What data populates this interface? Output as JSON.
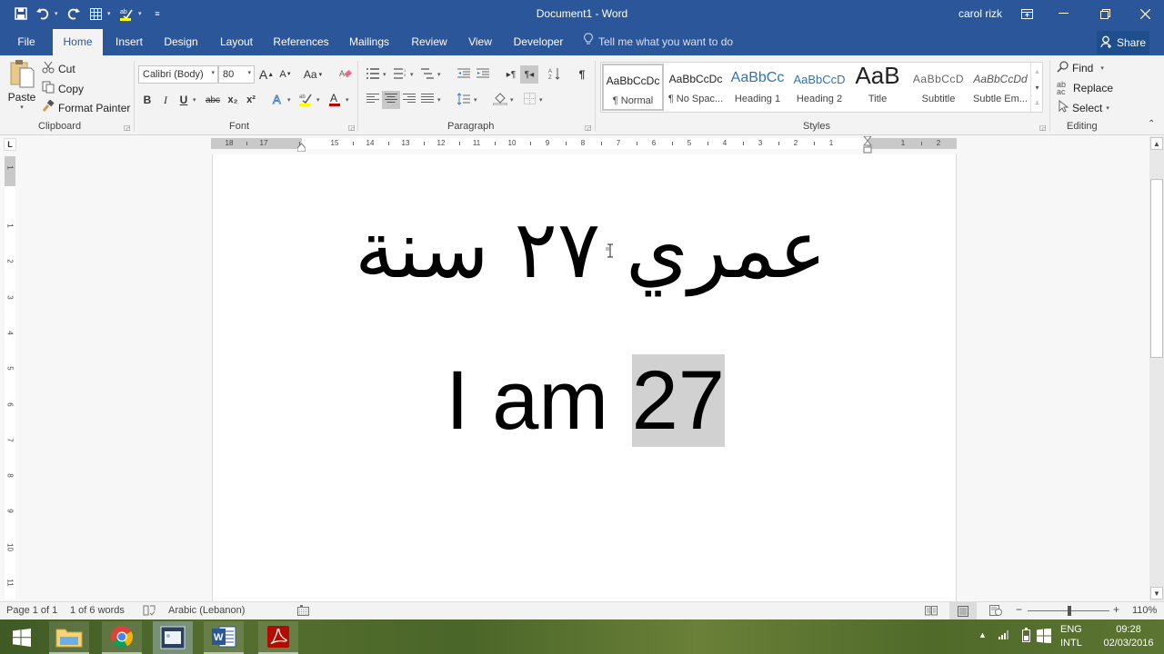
{
  "window": {
    "title": "Document1 - Word",
    "user": "carol rizk"
  },
  "quick_access": {
    "items": [
      "save-icon",
      "undo-icon",
      "redo-icon",
      "table-icon",
      "spelling-icon",
      "customize-icon"
    ]
  },
  "tabs": [
    {
      "label": "File",
      "active": false
    },
    {
      "label": "Home",
      "active": true
    },
    {
      "label": "Insert",
      "active": false
    },
    {
      "label": "Design",
      "active": false
    },
    {
      "label": "Layout",
      "active": false
    },
    {
      "label": "References",
      "active": false
    },
    {
      "label": "Mailings",
      "active": false
    },
    {
      "label": "Review",
      "active": false
    },
    {
      "label": "View",
      "active": false
    },
    {
      "label": "Developer",
      "active": false
    }
  ],
  "tellme": {
    "placeholder": "Tell me what you want to do"
  },
  "share": {
    "label": "Share"
  },
  "ribbon": {
    "clipboard": {
      "label": "Clipboard",
      "paste": "Paste",
      "cut": "Cut",
      "copy": "Copy",
      "format_painter": "Format Painter"
    },
    "font": {
      "label": "Font",
      "font_name": "Calibri (Body)",
      "font_size": "80",
      "buttons": {
        "bold": "B",
        "italic": "I",
        "underline": "U",
        "strike": "abc",
        "subscript": "x₂",
        "superscript": "x²"
      },
      "change_case": "Aa",
      "grow": "A",
      "shrink": "A"
    },
    "paragraph": {
      "label": "Paragraph"
    },
    "styles": {
      "label": "Styles",
      "items": [
        {
          "preview": "AaBbCcDc",
          "name": "¶ Normal",
          "selected": true
        },
        {
          "preview": "AaBbCcDc",
          "name": "¶ No Spac...",
          "selected": false
        },
        {
          "preview": "AaBbCc",
          "name": "Heading 1",
          "selected": false
        },
        {
          "preview": "AaBbCcD",
          "name": "Heading 2",
          "selected": false
        },
        {
          "preview": "AaB",
          "name": "Title",
          "selected": false
        },
        {
          "preview": "AaBbCcD",
          "name": "Subtitle",
          "selected": false
        },
        {
          "preview": "AaBbCcDd",
          "name": "Subtle Em...",
          "selected": false
        }
      ]
    },
    "editing": {
      "label": "Editing",
      "find": "Find",
      "replace": "Replace",
      "select": "Select"
    }
  },
  "ruler": {
    "h_numbers": [
      "18",
      "17",
      "15",
      "14",
      "13",
      "12",
      "11",
      "10",
      "9",
      "8",
      "7",
      "6",
      "5",
      "4",
      "3",
      "2",
      "1",
      "1",
      "2"
    ],
    "v_numbers": [
      "1",
      "1",
      "2",
      "3",
      "4",
      "5",
      "6",
      "7",
      "8",
      "9",
      "10",
      "11"
    ]
  },
  "document": {
    "arabic_text": "عمري ٢٧ سنة",
    "english_prefix": "I am ",
    "english_selected": "27"
  },
  "status": {
    "page": "Page 1 of 1",
    "words": "1 of 6 words",
    "language": "Arabic (Lebanon)",
    "zoom": "110%",
    "zoom_value_percent": 110
  },
  "taskbar": {
    "apps": [
      "start-icon",
      "file-explorer-icon",
      "chrome-icon",
      "photo-viewer-icon",
      "word-icon",
      "acrobat-icon"
    ],
    "lang_top": "ENG",
    "lang_bottom": "INTL",
    "time": "09:28",
    "date": "02/03/2016"
  },
  "colors": {
    "word_blue": "#2b579a",
    "selection": "#d1d1d1",
    "font_color_underline": "#c00000",
    "highlight_yellow": "#ffff00"
  }
}
